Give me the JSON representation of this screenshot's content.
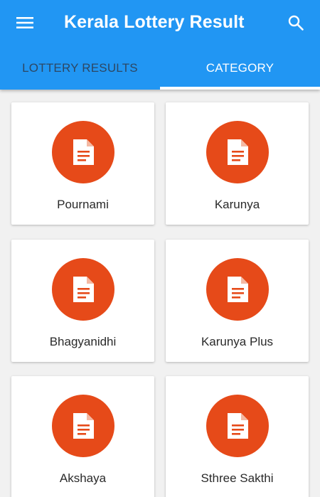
{
  "app": {
    "title": "Kerala Lottery Result",
    "menu_icon": "hamburger-menu-icon",
    "search_icon": "search-icon"
  },
  "colors": {
    "primary": "#2196f3",
    "accent": "#e64a19",
    "inactive_tab_text": "#2d4763",
    "background": "#f1f1f1"
  },
  "tabs": [
    {
      "label": "LOTTERY RESULTS",
      "selected": false
    },
    {
      "label": "CATEGORY",
      "selected": true
    }
  ],
  "categories": [
    {
      "label": "Pournami",
      "icon": "document-icon"
    },
    {
      "label": "Karunya",
      "icon": "document-icon"
    },
    {
      "label": "Bhagyanidhi",
      "icon": "document-icon"
    },
    {
      "label": "Karunya Plus",
      "icon": "document-icon"
    },
    {
      "label": "Akshaya",
      "icon": "document-icon"
    },
    {
      "label": "Sthree Sakthi",
      "icon": "document-icon"
    }
  ]
}
